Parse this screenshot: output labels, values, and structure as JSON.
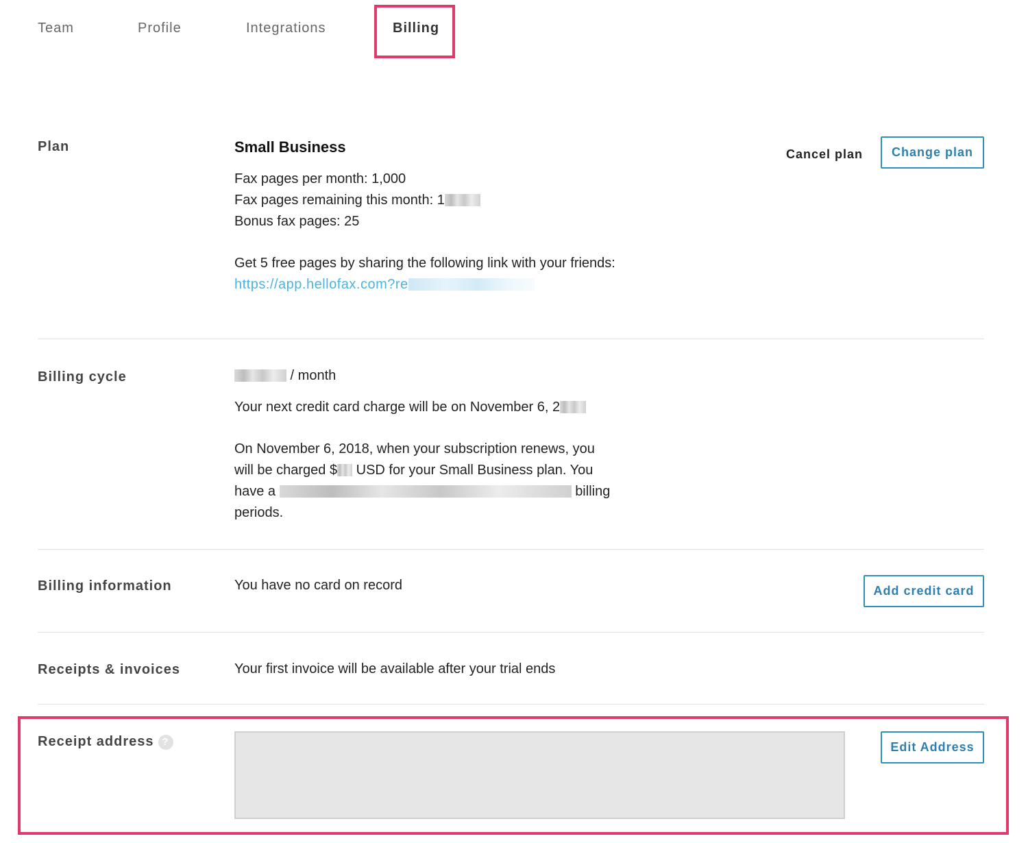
{
  "tabs": [
    {
      "label": "Team"
    },
    {
      "label": "Profile"
    },
    {
      "label": "Integrations"
    },
    {
      "label": "Billing"
    }
  ],
  "plan": {
    "label": "Plan",
    "name": "Small Business",
    "pages_per_month": "Fax pages per month: 1,000",
    "pages_remaining_prefix": "Fax pages remaining this month: 1",
    "bonus_pages": "Bonus fax pages: 25",
    "share_text": "Get 5 free pages by sharing the following link with your friends:",
    "share_link_prefix": "https://app.hellofax.com?re",
    "cancel_label": "Cancel plan",
    "change_label": "Change plan"
  },
  "billing_cycle": {
    "label": "Billing cycle",
    "price_suffix": " / month",
    "next_charge_prefix": "Your next credit card charge will be on November 6, 2",
    "renew_line1": "On November 6, 2018, when your subscription renews, you",
    "renew_line2_a": "will be charged $",
    "renew_line2_b": " USD for your Small Business plan. You",
    "renew_line3_a": "have a",
    "renew_line3_b": "billing",
    "renew_line4": "periods."
  },
  "billing_info": {
    "label": "Billing information",
    "text": "You have no card on record",
    "add_card_label": "Add credit card"
  },
  "receipts": {
    "label": "Receipts & invoices",
    "text": "Your first invoice will be available after your trial ends"
  },
  "receipt_address": {
    "label": "Receipt address",
    "help_icon": "?",
    "edit_label": "Edit Address"
  },
  "colors": {
    "highlight": "#e03a6b",
    "accent": "#2b8fc0",
    "link": "#4cb3e0"
  }
}
